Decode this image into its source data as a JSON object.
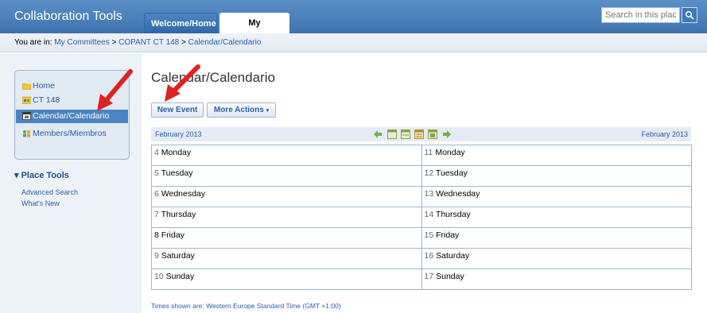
{
  "header": {
    "app_title": "Collaboration Tools",
    "tabs": [
      {
        "label": "Welcome/Home",
        "active": false
      },
      {
        "label": "My Committees",
        "active": true
      }
    ],
    "search": {
      "placeholder": "Search in this place"
    }
  },
  "breadcrumb": {
    "prefix": "You are in:",
    "items": [
      "My Committees",
      "COPANT CT 148",
      "Calendar/Calendario"
    ],
    "separator": ">"
  },
  "sidebar": {
    "items": [
      {
        "label": "Home",
        "icon": "folder-icon",
        "active": false
      },
      {
        "label": "CT 148",
        "icon": "committee-icon",
        "active": false
      },
      {
        "label": "Calendar/Calendario",
        "icon": "calendar-icon",
        "active": true
      },
      {
        "label": "Members/Miembros",
        "icon": "members-icon",
        "active": false
      }
    ],
    "place_tools": {
      "title": "Place Tools",
      "links": [
        "Advanced Search",
        "What's New"
      ]
    }
  },
  "main": {
    "title": "Calendar/Calendario",
    "buttons": {
      "new_event": "New Event",
      "more_actions": "More Actions"
    },
    "calendar": {
      "month_left": "February 2013",
      "month_right": "February 2013",
      "week1": [
        {
          "num": "4",
          "day": "Monday"
        },
        {
          "num": "5",
          "day": "Tuesday"
        },
        {
          "num": "6",
          "day": "Wednesday"
        },
        {
          "num": "7",
          "day": "Thursday"
        },
        {
          "num": "8",
          "day": "Friday",
          "today": true
        },
        {
          "num": "9",
          "day": "Saturday"
        },
        {
          "num": "10",
          "day": "Sunday"
        }
      ],
      "week2": [
        {
          "num": "11",
          "day": "Monday"
        },
        {
          "num": "12",
          "day": "Tuesday"
        },
        {
          "num": "13",
          "day": "Wednesday"
        },
        {
          "num": "14",
          "day": "Thursday"
        },
        {
          "num": "15",
          "day": "Friday"
        },
        {
          "num": "16",
          "day": "Saturday"
        },
        {
          "num": "17",
          "day": "Sunday"
        }
      ]
    },
    "timezone_note": "Times shown are: Western Europe Standard Time (GMT +1:00)"
  },
  "colors": {
    "accent": "#3f73b0",
    "link": "#2a5ea8",
    "today": "#e8a020",
    "arrow": "#e02020"
  }
}
